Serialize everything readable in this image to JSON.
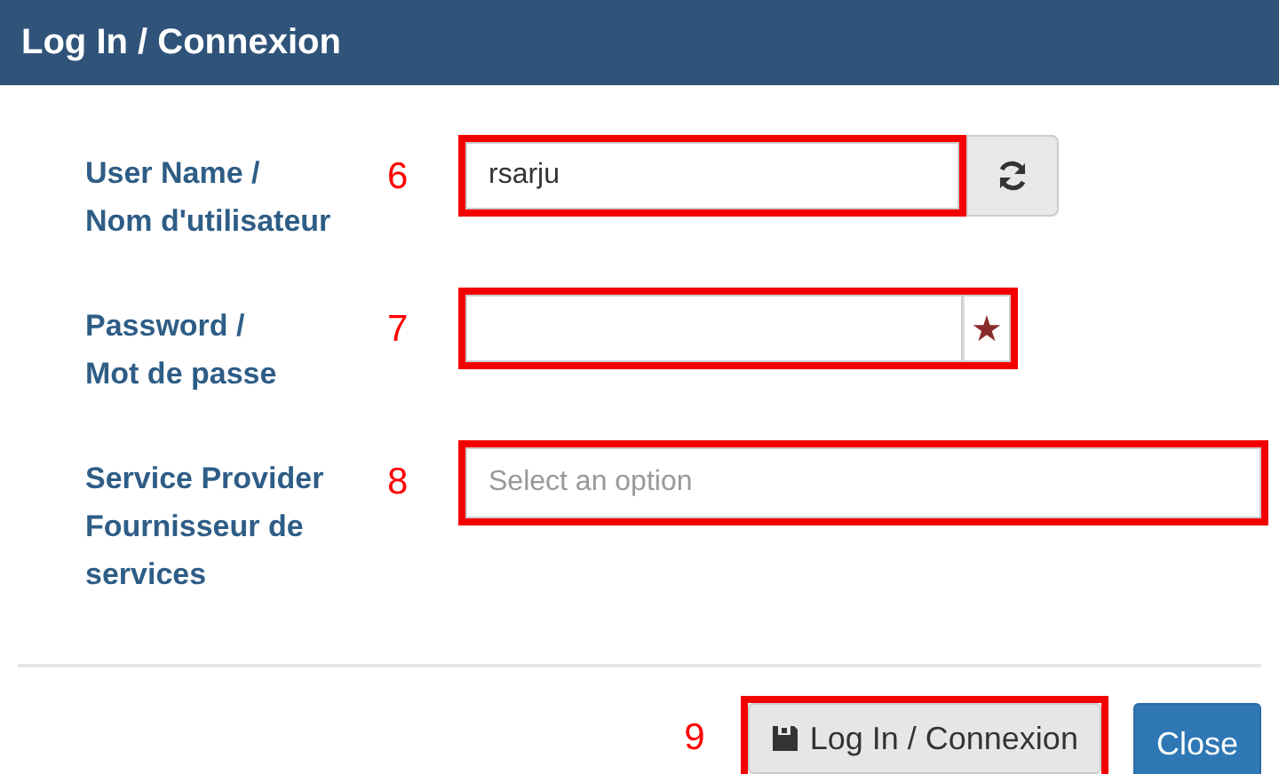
{
  "dialog": {
    "title": "Log In / Connexion"
  },
  "fields": [
    {
      "kind": "text",
      "label": [
        "User Name /",
        "Nom d'utilisateur"
      ],
      "callout": "6",
      "value": "rsarju",
      "addon": {
        "kind": "refresh"
      }
    },
    {
      "kind": "password",
      "label": [
        "Password /",
        "Mot de passe"
      ],
      "callout": "7",
      "addon": {
        "kind": "required",
        "symbol": "★"
      }
    },
    {
      "kind": "select",
      "label": [
        "Service Provider",
        "Fournisseur de",
        "services"
      ],
      "callout": "8",
      "placeholder": "Select an option"
    }
  ],
  "footer": {
    "callout": "9",
    "buttons": [
      {
        "label": "Log In / Connexion",
        "kind": "save",
        "highlighted": true
      },
      {
        "label": "Close",
        "kind": "primary",
        "highlighted": false
      }
    ]
  }
}
